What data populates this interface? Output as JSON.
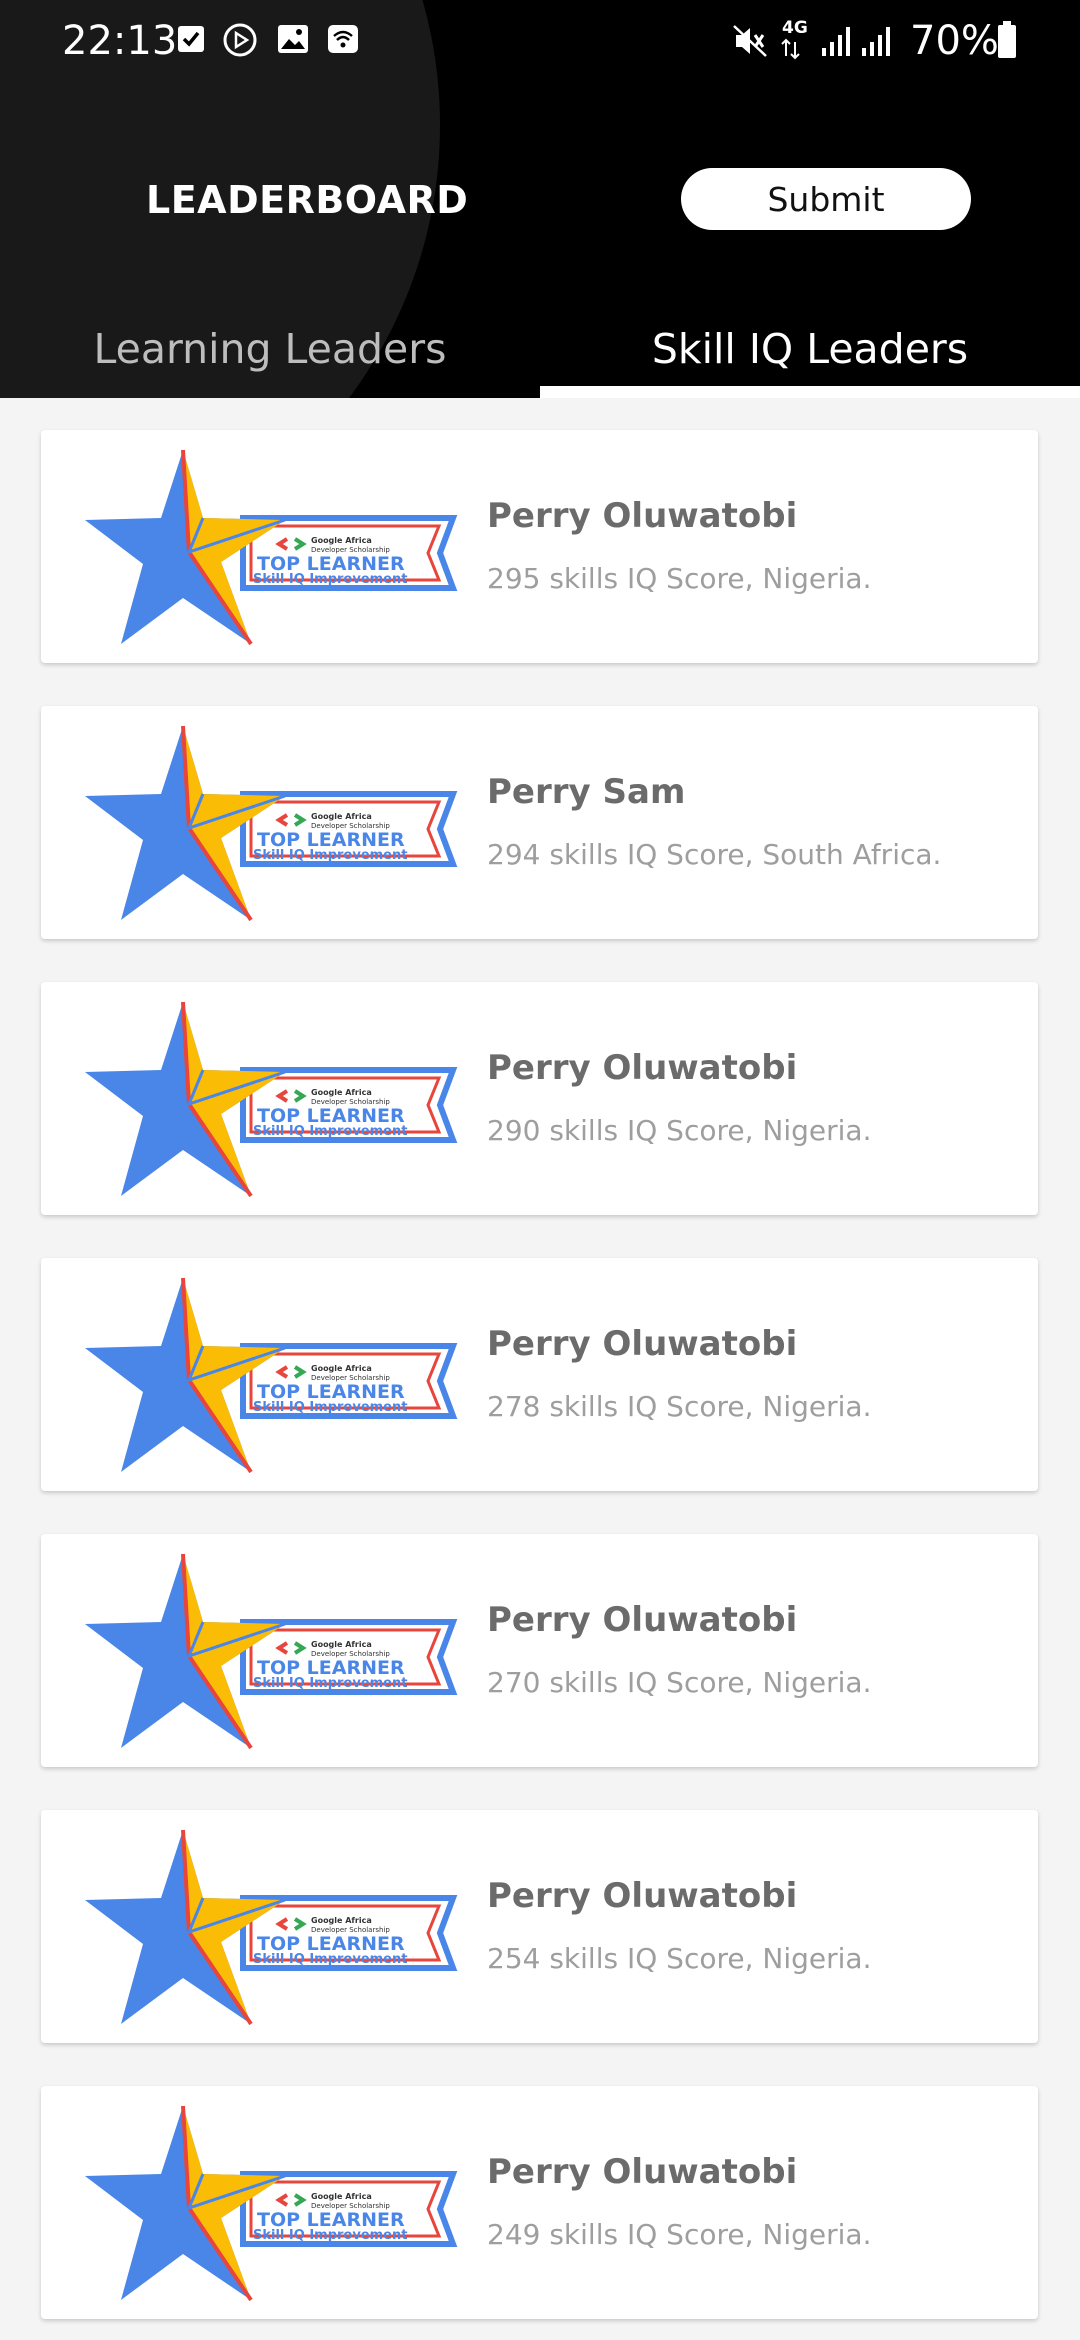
{
  "status_bar": {
    "time": "22:13",
    "network": "4G",
    "battery": "70%",
    "icons": [
      "check-box-icon",
      "play-icon",
      "image-icon",
      "wifi-icon",
      "mute-icon",
      "signal-icon",
      "signal-icon",
      "battery-icon"
    ]
  },
  "app_bar": {
    "title": "LEADERBOARD",
    "submit_label": "Submit"
  },
  "tabs": [
    {
      "label": "Learning Leaders",
      "selected": false
    },
    {
      "label": "Skill IQ Leaders",
      "selected": true
    }
  ],
  "badge": {
    "brand_line1": "Google Africa",
    "brand_line2": "Developer Scholarship",
    "headline": "TOP LEARNER",
    "subline": "Skill IQ Improvement"
  },
  "leaders": [
    {
      "name": "Perry Oluwatobi",
      "detail": "295 skills IQ Score, Nigeria."
    },
    {
      "name": "Perry Sam",
      "detail": "294 skills IQ Score, South Africa."
    },
    {
      "name": "Perry Oluwatobi",
      "detail": "290 skills IQ Score, Nigeria."
    },
    {
      "name": "Perry Oluwatobi",
      "detail": "278 skills IQ Score, Nigeria."
    },
    {
      "name": "Perry Oluwatobi",
      "detail": "270 skills IQ Score, Nigeria."
    },
    {
      "name": "Perry Oluwatobi",
      "detail": "254 skills IQ Score, Nigeria."
    },
    {
      "name": "Perry Oluwatobi",
      "detail": "249 skills IQ Score, Nigeria."
    }
  ],
  "colors": {
    "appbar": "#000000",
    "star_blue": "#4a86e8",
    "star_yellow": "#fbbc05",
    "banner_red": "#e8453c"
  }
}
